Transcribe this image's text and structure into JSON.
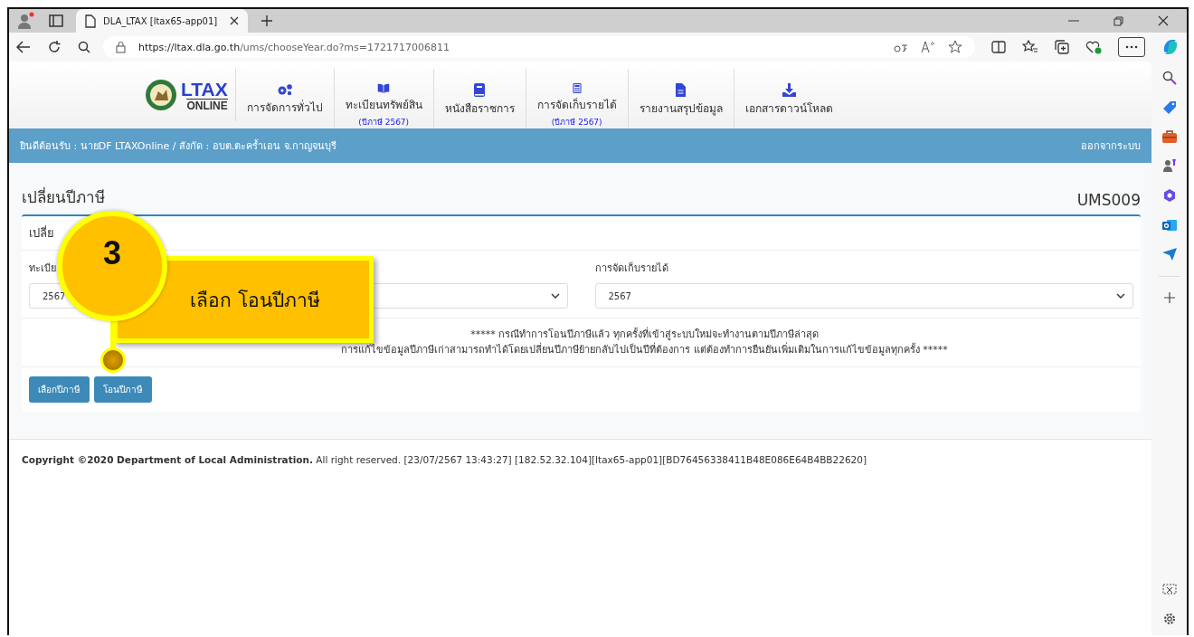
{
  "browser": {
    "tab_title": "DLA_LTAX [ltax65-app01]",
    "url_host": "https://ltax.dla.go.th",
    "url_path": "/ums/chooseYear.do?ms=1721717006811"
  },
  "logo": {
    "title": "LTAX",
    "subtitle": "ONLINE"
  },
  "nav": [
    {
      "kind": "gears",
      "label": "การจัดการทั่วไป"
    },
    {
      "kind": "book",
      "label": "ทะเบียนทรัพย์สิน",
      "sub": "(ปีภาษี 2567)"
    },
    {
      "kind": "notebook",
      "label": "หนังสือราชการ"
    },
    {
      "kind": "calculator",
      "label": "การจัดเก็บรายได้",
      "sub": "(ปีภาษี 2567)"
    },
    {
      "kind": "file",
      "label": "รายงานสรุปข้อมูล"
    },
    {
      "kind": "download",
      "label": "เอกสารดาวน์โหลด"
    }
  ],
  "welcome": "ยินดีต้อนรับ : นายDF LTAXOnline / สังกัด : อบต.ตะคร้ำเอน จ.กาญจนบุรี",
  "logout": "ออกจากระบบ",
  "page": {
    "title": "เปลี่ยนปีภาษี",
    "code": "UMS009"
  },
  "card": {
    "header": "เปลี่ย"
  },
  "fields": [
    {
      "label": "ทะเบีย",
      "value": "2567"
    },
    {
      "label": "การจัดเก็บรายได้",
      "value": "2567"
    }
  ],
  "notice": [
    "***** กรณีทำการโอนปีภาษีแล้ว ทุกครั้งที่เข้าสู่ระบบใหม่จะทำงานตามปีภาษีล่าสุด",
    "การแก้ไขข้อมูลปีภาษีเก่าสามารถทำได้โดยเปลี่ยนปีภาษีย้ายกลับไปเป็นปีที่ต้องการ แต่ต้องทำการยืนยันเพิ่มเติมในการแก้ไขข้อมูลทุกครั้ง *****"
  ],
  "buttons": [
    "เลือกปีภาษี",
    "โอนปีภาษี"
  ],
  "callout": {
    "number": "3",
    "text": "เลือก โอนปีภาษี"
  },
  "footer": "**Copyright ©2020 Department of Local Administration.** All right reserved. [23/07/2567 13:43:27] [182.52.32.104][ltax65-app01][BD76456338411B48E086E64B4BB22620]"
}
